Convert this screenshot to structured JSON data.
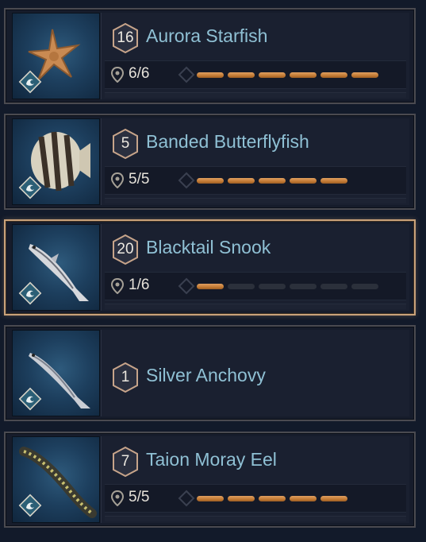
{
  "fish": [
    {
      "level": "16",
      "name": "Aurora Starfish",
      "has_progress": true,
      "count_text": "6/6",
      "caught": 6,
      "total": 6,
      "selected": false,
      "art": "starfish"
    },
    {
      "level": "5",
      "name": "Banded Butterflyfish",
      "has_progress": true,
      "count_text": "5/5",
      "caught": 5,
      "total": 5,
      "selected": false,
      "art": "butterflyfish"
    },
    {
      "level": "20",
      "name": "Blacktail Snook",
      "has_progress": true,
      "count_text": "1/6",
      "caught": 1,
      "total": 6,
      "selected": true,
      "art": "snook"
    },
    {
      "level": "1",
      "name": "Silver Anchovy",
      "has_progress": false,
      "selected": false,
      "art": "anchovy"
    },
    {
      "level": "7",
      "name": "Taion Moray Eel",
      "has_progress": true,
      "count_text": "5/5",
      "caught": 5,
      "total": 5,
      "selected": false,
      "art": "eel"
    }
  ],
  "icons": {
    "habitat": "water-wave-icon",
    "location": "location-pin-icon",
    "level": "hexagon-level-badge"
  },
  "colors": {
    "progress_filled": "#c27a34",
    "progress_empty": "#2b303b",
    "selected_border": "#c9a27a",
    "name_text": "#8fc0d4"
  }
}
